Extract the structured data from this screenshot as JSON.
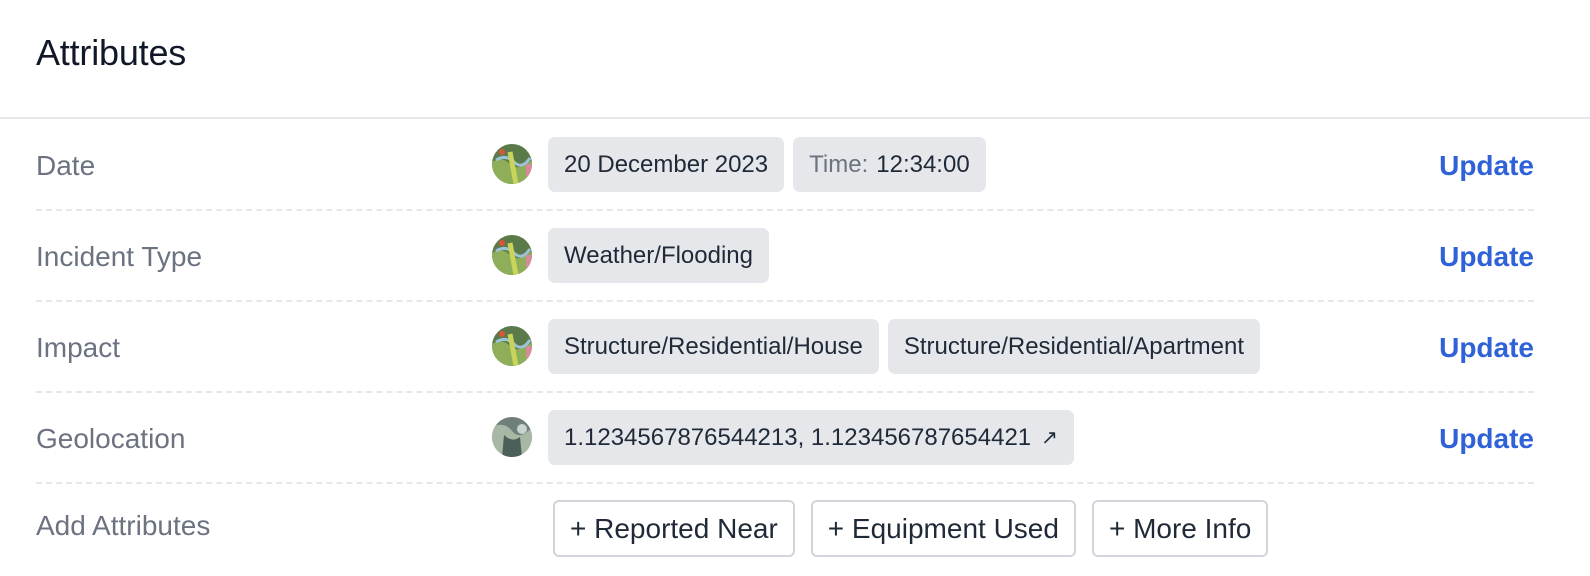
{
  "header": {
    "title": "Attributes"
  },
  "colors": {
    "accent": "#2f62d8",
    "label": "#6b7280",
    "chip_bg": "#e5e7eb"
  },
  "rows": [
    {
      "label": "Date",
      "avatar_icon": "user-avatar-landscape",
      "chips": [
        {
          "prefix": "",
          "value": "20 December 2023"
        },
        {
          "prefix": "Time:",
          "value": "12:34:00"
        }
      ],
      "action": "Update"
    },
    {
      "label": "Incident Type",
      "avatar_icon": "user-avatar-landscape",
      "chips": [
        {
          "prefix": "",
          "value": "Weather/Flooding"
        }
      ],
      "action": "Update"
    },
    {
      "label": "Impact",
      "avatar_icon": "user-avatar-landscape",
      "chips": [
        {
          "prefix": "",
          "value": "Structure/Residential/House"
        },
        {
          "prefix": "",
          "value": "Structure/Residential/Apartment"
        }
      ],
      "action": "Update"
    },
    {
      "label": "Geolocation",
      "avatar_icon": "user-avatar-grey",
      "chips": [
        {
          "prefix": "",
          "value": "1.1234567876544213, 1.123456787654421",
          "icon": "↗"
        }
      ],
      "action": "Update"
    }
  ],
  "add_attributes": {
    "label": "Add Attributes",
    "buttons": [
      "+ Reported Near",
      "+ Equipment Used",
      "+ More Info"
    ]
  }
}
